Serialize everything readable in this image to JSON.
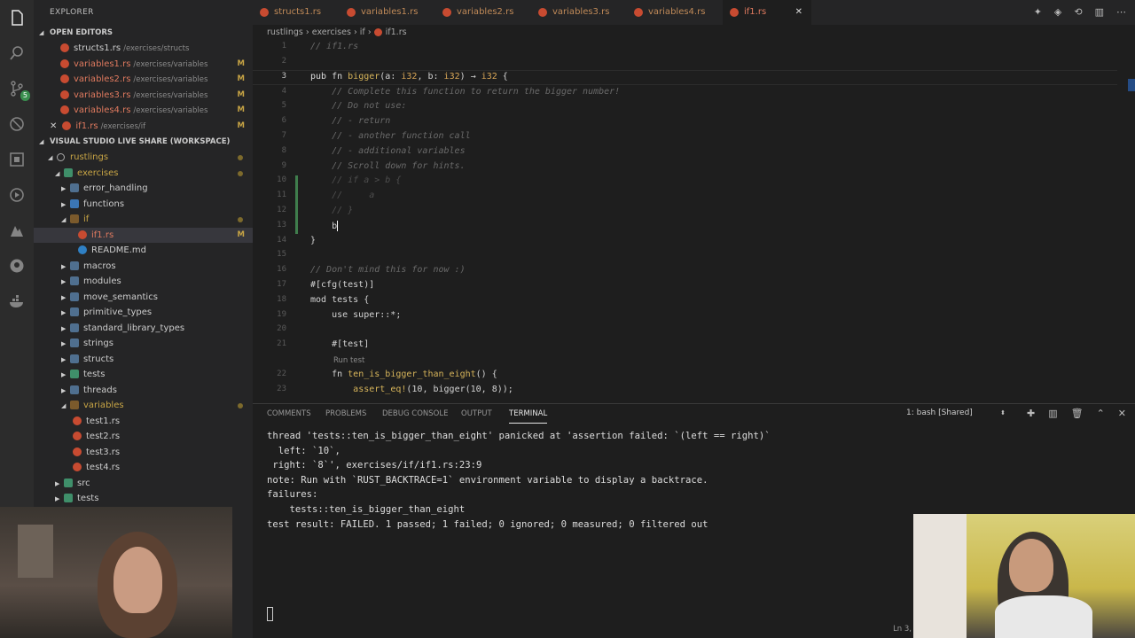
{
  "activity": {
    "scm_badge": "5"
  },
  "explorer": {
    "title": "EXPLORER",
    "open_editors_title": "OPEN EDITORS",
    "open_editors": [
      {
        "name": "structs1.rs",
        "path": "/exercises/structs",
        "mod": ""
      },
      {
        "name": "variables1.rs",
        "path": "/exercises/variables",
        "mod": "M"
      },
      {
        "name": "variables2.rs",
        "path": "/exercises/variables",
        "mod": "M"
      },
      {
        "name": "variables3.rs",
        "path": "/exercises/variables",
        "mod": "M"
      },
      {
        "name": "variables4.rs",
        "path": "/exercises/variables",
        "mod": "M"
      },
      {
        "name": "if1.rs",
        "path": "/exercises/if",
        "mod": "M"
      }
    ],
    "workspace_title": "VISUAL STUDIO LIVE SHARE (WORKSPACE)",
    "tree": {
      "root": "rustlings",
      "exercises": "exercises",
      "items": [
        {
          "label": "error_handling"
        },
        {
          "label": "functions"
        },
        {
          "label": "if"
        },
        {
          "label": "if1.rs",
          "mod": "M"
        },
        {
          "label": "README.md"
        },
        {
          "label": "macros"
        },
        {
          "label": "modules"
        },
        {
          "label": "move_semantics"
        },
        {
          "label": "primitive_types"
        },
        {
          "label": "standard_library_types"
        },
        {
          "label": "strings"
        },
        {
          "label": "structs"
        },
        {
          "label": "tests"
        },
        {
          "label": "threads"
        },
        {
          "label": "variables"
        },
        {
          "label": "test1.rs"
        },
        {
          "label": "test2.rs"
        },
        {
          "label": "test3.rs"
        },
        {
          "label": "test4.rs"
        },
        {
          "label": "src"
        },
        {
          "label": "tests"
        }
      ]
    }
  },
  "tabs": [
    "structs1.rs",
    "variables1.rs",
    "variables2.rs",
    "variables3.rs",
    "variables4.rs",
    "if1.rs"
  ],
  "breadcrumb": {
    "a": "rustlings",
    "b": "exercises",
    "c": "if",
    "d": "if1.rs"
  },
  "editor": {
    "line_numbers": [
      "1",
      "2",
      "3",
      "4",
      "5",
      "6",
      "7",
      "8",
      "9",
      "10",
      "11",
      "12",
      "13",
      "14",
      "15",
      "16",
      "17",
      "18",
      "19",
      "20",
      "21",
      "22",
      "23"
    ],
    "lines": {
      "l1": "// if1.rs",
      "l3a": "pub fn ",
      "l3b": "bigger",
      "l3c": "(a: ",
      "l3d": "i32",
      "l3e": ", b: ",
      "l3f": "i32",
      "l3g": ") → ",
      "l3h": "i32",
      "l3i": " {",
      "l4": "    // Complete this function to return the bigger number!",
      "l5": "    // Do not use:",
      "l6": "    // - return",
      "l7": "    // - another function call",
      "l8": "    // - additional variables",
      "l9": "    // Scroll down for hints.",
      "l10": "    // if a > b {",
      "l11": "    //     a",
      "l12": "    // }",
      "l13": "    b",
      "l14": "}",
      "l16": "// Don't mind this for now :)",
      "l17": "#[cfg(test)]",
      "l18": "mod tests {",
      "l19": "    use super::*;",
      "l21": "    #[test]",
      "codelens": "Run test",
      "l22a": "    fn ",
      "l22b": "ten_is_bigger_than_eight",
      "l22c": "() {",
      "l23a": "        ",
      "l23b": "assert_eq!",
      "l23c": "(10, bigger(10, 8));"
    }
  },
  "panel": {
    "tabs": [
      "COMMENTS",
      "PROBLEMS",
      "DEBUG CONSOLE",
      "OUTPUT",
      "TERMINAL"
    ],
    "terminal_select": "1: bash [Shared]",
    "terminal_lines": [
      "thread 'tests::ten_is_bigger_than_eight' panicked at 'assertion failed: `(left == right)`",
      "  left: `10`,",
      " right: `8`', exercises/if/if1.rs:23:9",
      "note: Run with `RUST_BACKTRACE=1` environment variable to display a backtrace.",
      "",
      "",
      "failures:",
      "    tests::ten_is_bigger_than_eight",
      "",
      "test result: FAILED. 1 passed; 1 failed; 0 ignored; 0 measured; 0 filtered out"
    ]
  },
  "status": {
    "cursor": "Ln 3,"
  }
}
